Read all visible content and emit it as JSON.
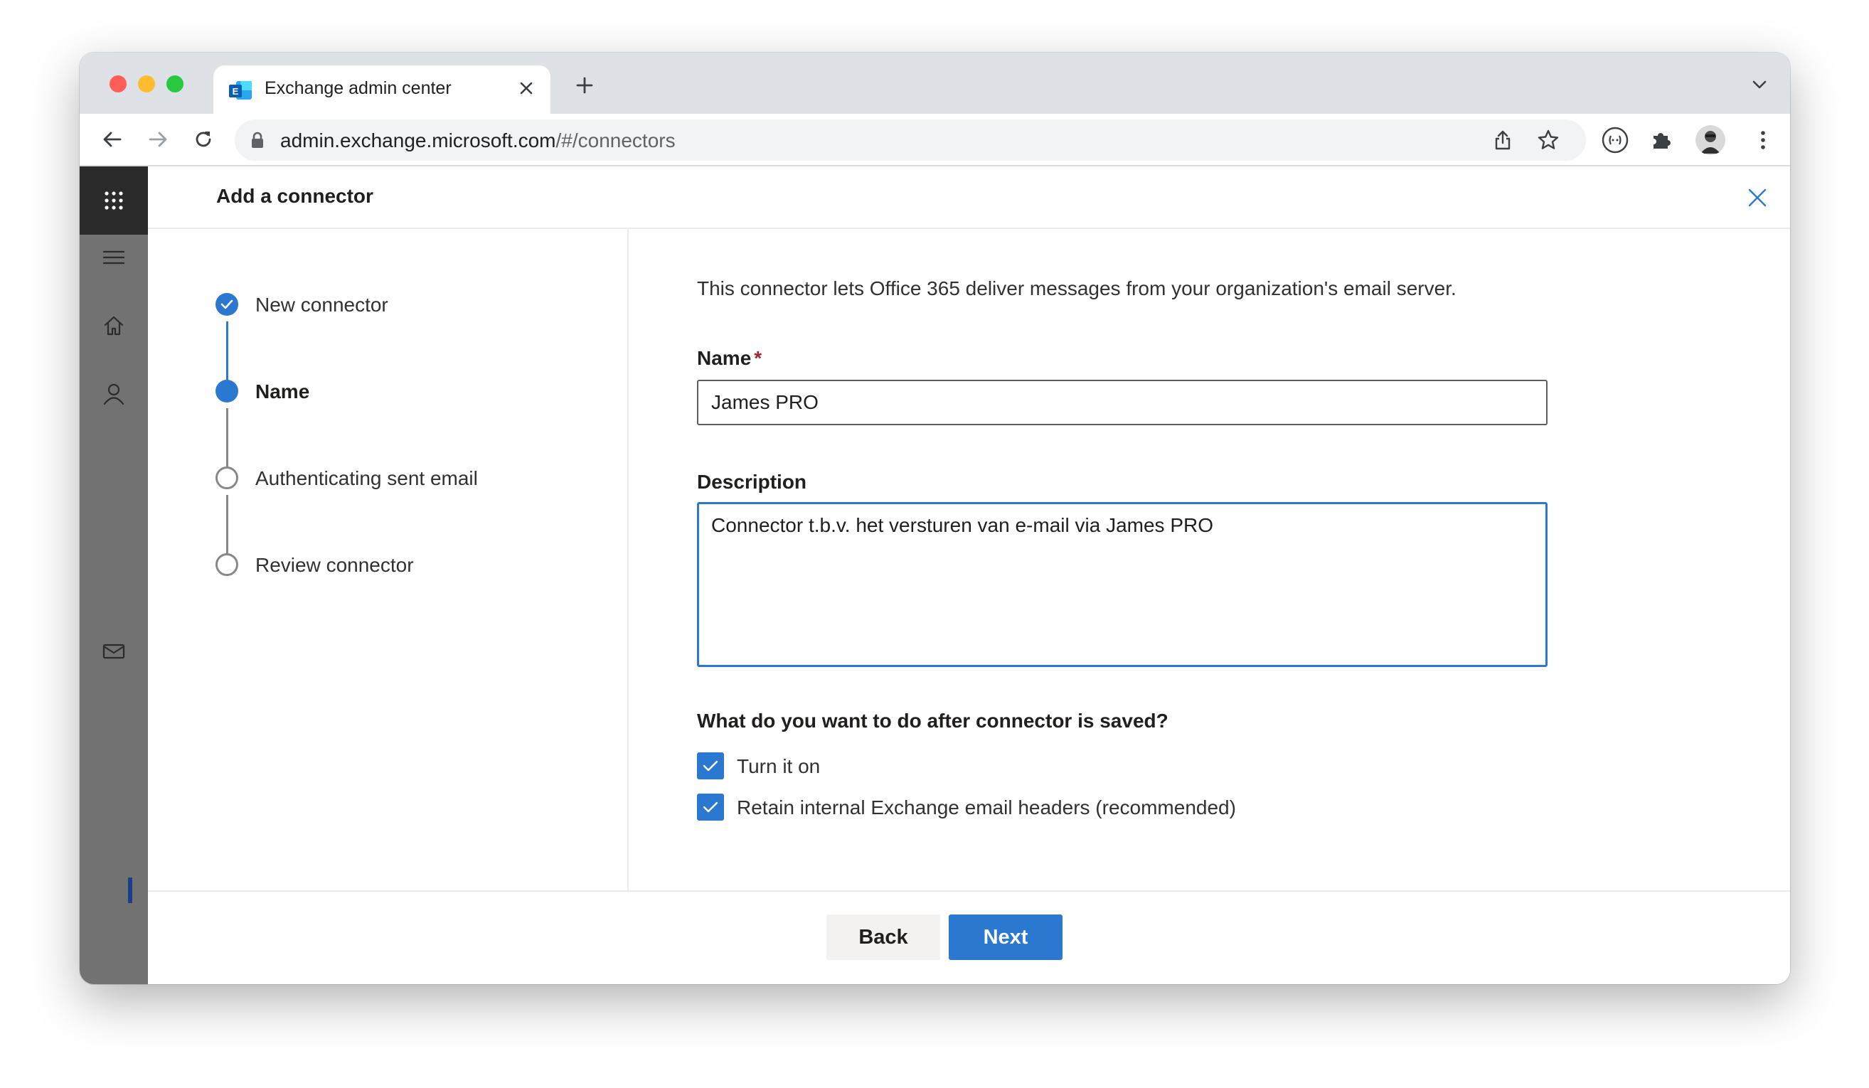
{
  "browser": {
    "tab_title": "Exchange admin center",
    "url_host": "admin.exchange.microsoft.com",
    "url_path": "/#/connectors",
    "icons": [
      "back-icon",
      "forward-icon",
      "reload-icon",
      "lock-icon",
      "share-icon",
      "star-icon",
      "extension-icon",
      "puzzle-icon",
      "kebab-menu-icon",
      "chevron-down-icon",
      "plus-icon",
      "close-icon"
    ]
  },
  "rail": {
    "icons": [
      "waffle-icon",
      "hamburger-icon",
      "home-icon",
      "person-icon",
      "mail-icon"
    ]
  },
  "panel": {
    "title": "Add a connector"
  },
  "steps": [
    {
      "label": "New connector",
      "state": "done"
    },
    {
      "label": "Name",
      "state": "current"
    },
    {
      "label": "Authenticating sent email",
      "state": "todo"
    },
    {
      "label": "Review connector",
      "state": "todo"
    }
  ],
  "form": {
    "intro": "This connector lets Office 365 deliver messages from your organization's email server.",
    "name_label": "Name",
    "required_marker": "*",
    "name_value": "James PRO",
    "description_label": "Description",
    "description_value": "Connector t.b.v. het versturen van e-mail via James PRO",
    "question": "What do you want to do after connector is saved?",
    "options": [
      {
        "label": "Turn it on",
        "checked": true
      },
      {
        "label": "Retain internal Exchange email headers (recommended)",
        "checked": true
      }
    ]
  },
  "footer": {
    "back_label": "Back",
    "next_label": "Next"
  },
  "colors": {
    "accent": "#2b78d0",
    "rail": "#727272",
    "rail_top": "#2b2b2b",
    "required": "#a4262c"
  }
}
